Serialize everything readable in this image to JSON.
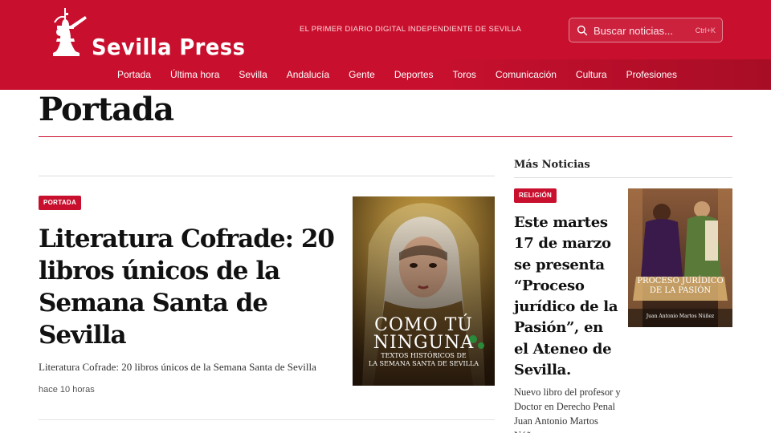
{
  "header": {
    "brand": "Sevilla Press",
    "tagline": "EL PRIMER DIARIO DIGITAL INDEPENDIENTE DE SEVILLA",
    "search_placeholder": "Buscar noticias...",
    "search_shortcut": "Ctrl+K",
    "brand_color": "#c8102e"
  },
  "nav": {
    "items": [
      {
        "label": "Portada"
      },
      {
        "label": "Última hora"
      },
      {
        "label": "Sevilla"
      },
      {
        "label": "Andalucía"
      },
      {
        "label": "Gente"
      },
      {
        "label": "Deportes"
      },
      {
        "label": "Toros"
      },
      {
        "label": "Comunicación"
      },
      {
        "label": "Cultura"
      },
      {
        "label": "Profesiones"
      }
    ]
  },
  "page": {
    "title": "Portada"
  },
  "main_article": {
    "category": "PORTADA",
    "headline": "Literatura Cofrade: 20 libros únicos de la Semana Santa de Sevilla",
    "excerpt": "Literatura Cofrade: 20 libros únicos de la Semana Santa de Sevilla",
    "time": "hace 10 horas",
    "image": {
      "title_line1": "COMO TÚ",
      "title_line2": "NINGUNA",
      "subtitle_line1": "TEXTOS HISTÓRICOS DE",
      "subtitle_line2": "LA SEMANA SANTA DE SEVILLA"
    }
  },
  "sidebar": {
    "title": "Más Noticias",
    "article": {
      "category": "RELIGIÓN",
      "headline": "Este martes  17 de marzo se presenta “Proceso jurídico de la Pasión”, en el Ateneo de Sevilla.",
      "excerpt": " Nuevo libro del profesor y Doctor en Derecho Penal Juan Antonio Martos Núñez",
      "image": {
        "title_line1": "PROCESO JURÍDICO",
        "title_line2": "DE LA PASIÓN",
        "author": "Juan Antonio Martos Núñez"
      }
    }
  }
}
